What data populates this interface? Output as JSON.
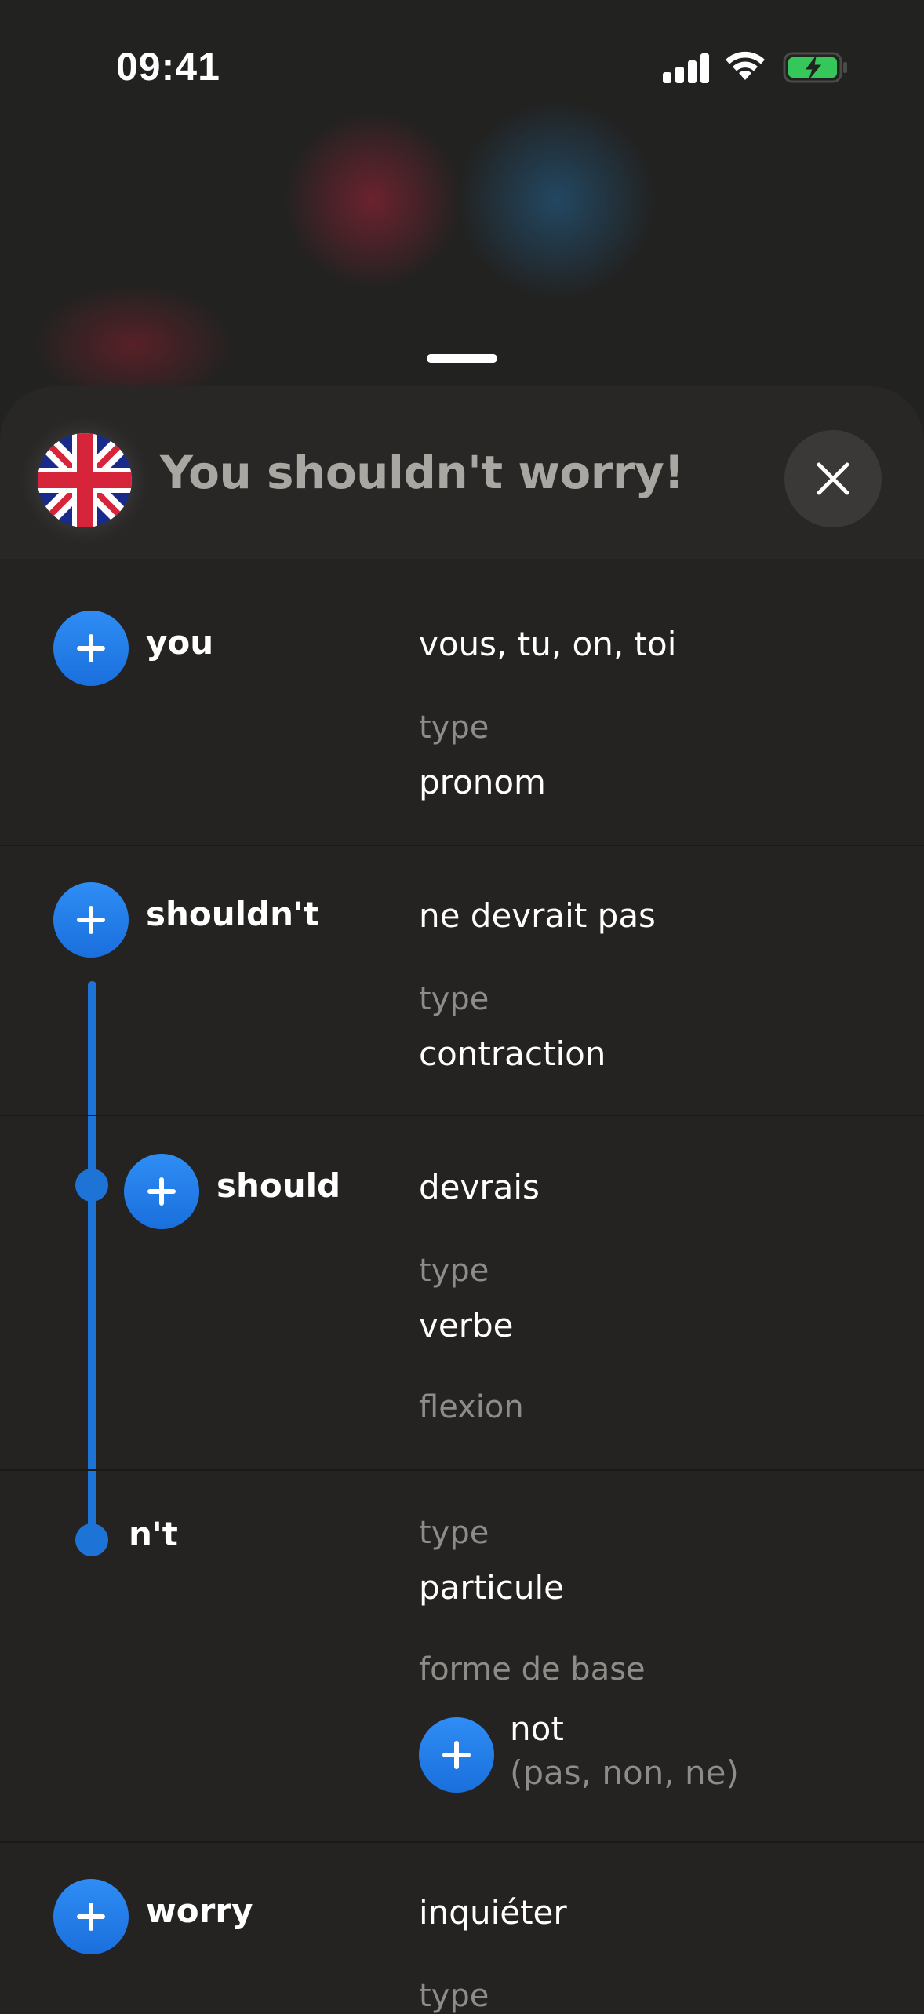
{
  "status_bar": {
    "time": "09:41"
  },
  "header": {
    "sentence": "You shouldn't worry!",
    "flag": "uk-flag-icon",
    "close": "close-icon"
  },
  "entries": [
    {
      "word": "you",
      "translation": "vous, tu, on, toi",
      "type_label": "type",
      "type_value": "pronom"
    },
    {
      "word": "shouldn't",
      "translation": "ne devrait pas",
      "type_label": "type",
      "type_value": "contraction"
    },
    {
      "word": "should",
      "translation": "devrais",
      "type_label": "type",
      "type_value": "verbe",
      "extra_label": "flexion"
    },
    {
      "word": "n't",
      "type_label": "type",
      "type_value": "particule",
      "base_label": "forme de base",
      "base_word": "not",
      "base_translation": "(pas, non, ne)"
    },
    {
      "word": "worry",
      "translation": "inquiéter",
      "type_label": "type"
    }
  ],
  "colors": {
    "accent": "#1d74d6",
    "background": "#242321",
    "muted": "#8e8c88"
  }
}
